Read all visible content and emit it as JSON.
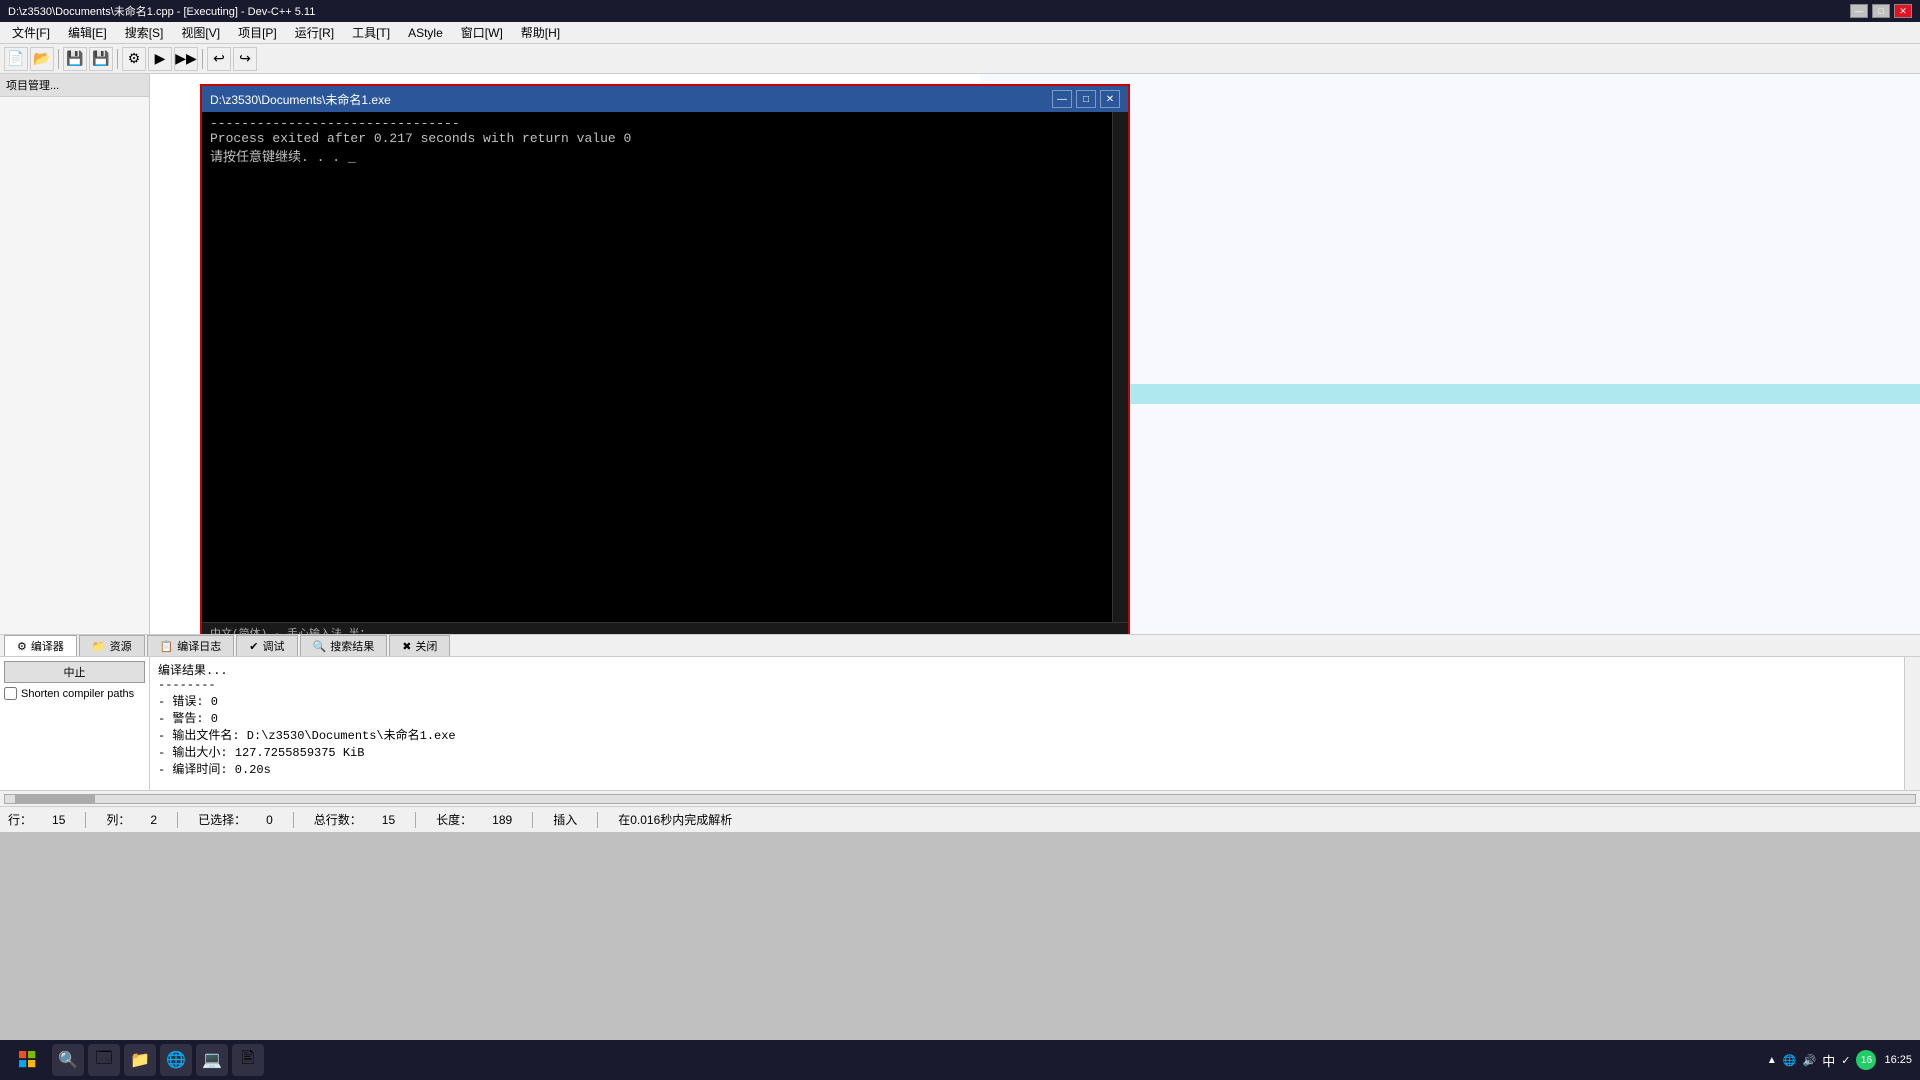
{
  "window": {
    "title": "D:\\z3530\\Documents\\未命名1.cpp - [Executing] - Dev-C++ 5.11",
    "min_btn": "—",
    "max_btn": "□",
    "close_btn": "✕"
  },
  "menu": {
    "items": [
      "文件[F]",
      "编辑[E]",
      "搜索[S]",
      "视图[V]",
      "项目[P]",
      "运行[R]",
      "工具[T]",
      "AStyle",
      "窗口[W]",
      "帮助[H]"
    ]
  },
  "left_panel": {
    "header": "项目管理..."
  },
  "console": {
    "title": "D:\\z3530\\Documents\\未命名1.exe",
    "min_btn": "—",
    "max_btn": "□",
    "close_btn": "✕",
    "line1": "--------------------------------",
    "line2": "Process exited after 0.217 seconds with return value 0",
    "line3": "请按任意键继续. . . _",
    "ime_status": "中文(简体) - 手心输入法 半："
  },
  "bottom_tabs": [
    {
      "label": "编译器",
      "icon": "⚙"
    },
    {
      "label": "资源",
      "icon": "📁"
    },
    {
      "label": "编译日志",
      "icon": "📋"
    },
    {
      "label": "调试",
      "icon": "✔"
    },
    {
      "label": "搜索结果",
      "icon": "🔍"
    },
    {
      "label": "关闭",
      "icon": "✖"
    }
  ],
  "bottom_panel": {
    "stop_btn": "中止",
    "shorten_paths_label": "Shorten compiler paths",
    "output_lines": [
      "编译结果...",
      "--------",
      "- 错误: 0",
      "- 警告: 0",
      "- 输出文件名: D:\\z3530\\Documents\\未命名1.exe",
      "- 输出大小: 127.7255859375 KiB",
      "- 编译时间: 0.20s"
    ]
  },
  "status_bar": {
    "row_label": "行：",
    "row_val": "15",
    "col_label": "列：",
    "col_val": "2",
    "sel_label": "已选择：",
    "sel_val": "0",
    "total_label": "总行数：",
    "total_val": "15",
    "len_label": "长度：",
    "len_val": "189",
    "mode_label": "插入",
    "parse_label": "在0.016秒内完成解析"
  },
  "taskbar": {
    "time": "16:25",
    "notification_count": "16",
    "ime_label": "中",
    "icons": [
      "⊞",
      "🌐",
      "📁",
      "💻",
      "🖹"
    ]
  }
}
